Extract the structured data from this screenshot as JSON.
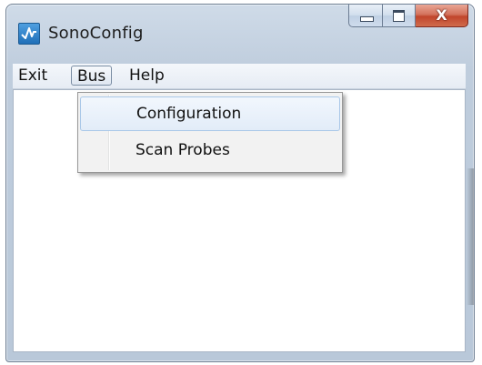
{
  "window": {
    "title": "SonoConfig",
    "icon": "waveform-app-icon",
    "controls": {
      "minimize_icon": "minimize-icon",
      "maximize_icon": "maximize-icon",
      "close_label": "X"
    }
  },
  "menubar": {
    "items": [
      {
        "label": "Exit"
      },
      {
        "label": "Bus",
        "open": true
      },
      {
        "label": "Help"
      }
    ]
  },
  "dropdown": {
    "parent": "Bus",
    "items": [
      {
        "label": "Configuration",
        "highlighted": true
      },
      {
        "label": "Scan Probes",
        "highlighted": false
      }
    ]
  },
  "colors": {
    "frame": "#c6d3e2",
    "close_button": "#c1462c",
    "highlight_border": "#a9c7e8",
    "client_background": "#ffffff"
  }
}
